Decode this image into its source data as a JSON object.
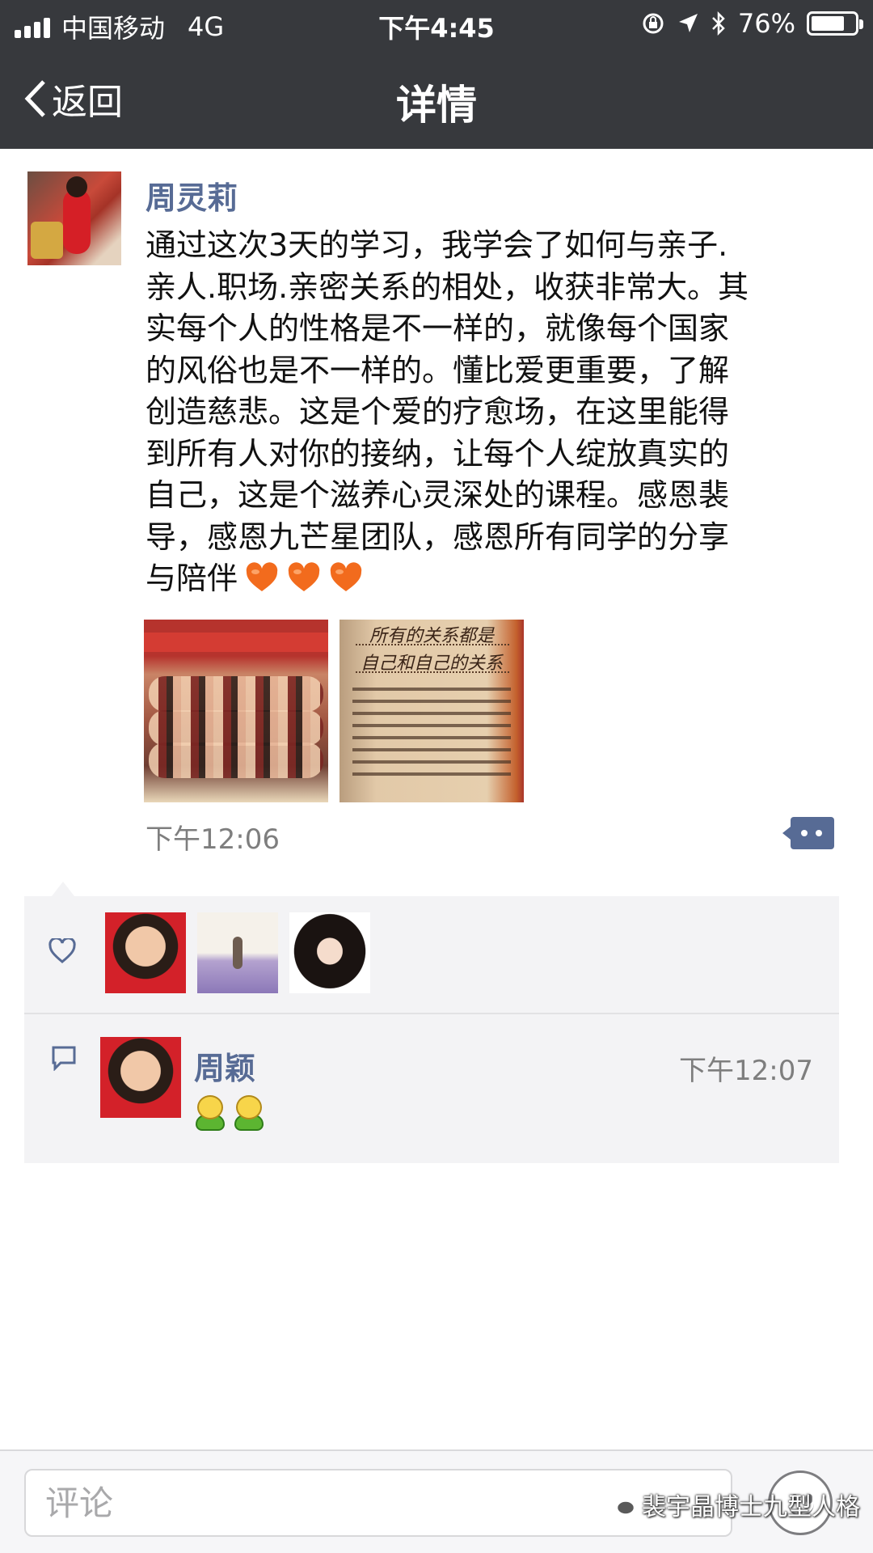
{
  "status_bar": {
    "carrier": "中国移动",
    "network": "4G",
    "time": "下午4:45",
    "battery_percent": "76%",
    "battery_level": 0.76
  },
  "nav": {
    "back_label": "返回",
    "title": "详情"
  },
  "post": {
    "author": "周灵莉",
    "text_lines": [
      "通过这次3天的学习，我学会了如何与亲子.",
      "亲人.职场.亲密关系的相处，收获非常大。其",
      "实每个人的性格是不一样的，就像每个国家",
      "的风俗也是不一样的。懂比爱更重要，了解",
      "创造慈悲。这是个爱的疗愈场，在这里能得",
      "到所有人对你的接纳，让每个人绽放真实的",
      "自己，这是个滋养心灵深处的课程。感恩裴",
      "导，感恩九芒星团队，感恩所有同学的分享",
      "与陪伴"
    ],
    "heart_emoji_count": 3,
    "photo2_heading_1": "所有的关系都是",
    "photo2_heading_2": "自己和自己的关系",
    "time": "下午12:06"
  },
  "likes": {
    "icon": "heart-outline-icon",
    "avatar_count": 3
  },
  "comment": {
    "icon": "comment-icon",
    "author": "周颖",
    "time": "下午12:07",
    "emoji_count": 2
  },
  "bottom_bar": {
    "placeholder": "评论",
    "emoji_button_icon": "smiley-icon"
  },
  "watermark": {
    "text": "裴宇晶博士九型人格"
  },
  "colors": {
    "nav_bg": "#37393d",
    "link_blue": "#576b95",
    "panel_bg": "#f3f3f5",
    "heart_orange": "#f26b1d",
    "timestamp_gray": "#7e7e7e"
  }
}
